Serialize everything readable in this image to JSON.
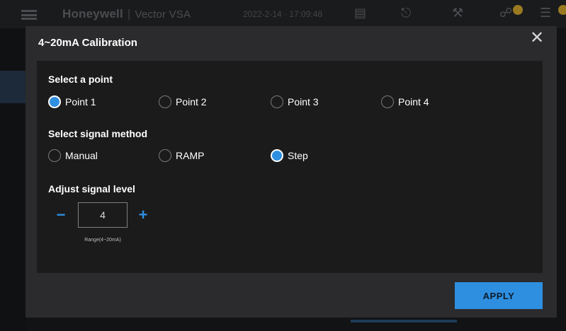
{
  "app": {
    "brand": "Honeywell",
    "product": "Vector VSA",
    "datetime": "2022-2-14 · 17:09:48",
    "header_icons": [
      "server-icon",
      "bell-icon",
      "tools-icon",
      "plug-icon",
      "checklist-icon"
    ]
  },
  "modal": {
    "title": "4~20mA Calibration",
    "close_icon": "close-icon",
    "select_point": {
      "label": "Select a point",
      "options": [
        "Point 1",
        "Point 2",
        "Point 3",
        "Point 4"
      ],
      "selected": "Point 1"
    },
    "signal_method": {
      "label": "Select signal method",
      "options": [
        "Manual",
        "RAMP",
        "Step"
      ],
      "selected": "Step"
    },
    "signal_level": {
      "label": "Adjust signal level",
      "decrement": "−",
      "increment": "+",
      "value": "4",
      "range_hint": "Range(4~20mA)"
    },
    "apply_label": "APPLY"
  },
  "colors": {
    "accent": "#2f8fe0",
    "modal_bg": "#2b2b2d",
    "panel_bg": "#1b1b1c"
  }
}
